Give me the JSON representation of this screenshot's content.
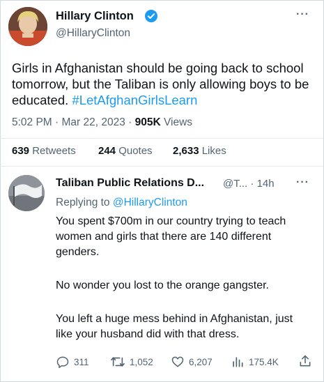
{
  "tweet": {
    "author": "Hillary Clinton",
    "handle": "@HillaryClinton",
    "text": "Girls in Afghanistan should be going back to school tomorrow, but the Taliban is only allowing boys to be educated. ",
    "hashtag": "#LetAfghanGirlsLearn",
    "time": "5:02 PM · Mar 22, 2023 · ",
    "views_count": "905K",
    "views_label": " Views",
    "retweets_count": "639",
    "retweets_label": " Retweets",
    "quotes_count": "244",
    "quotes_label": " Quotes",
    "likes_count": "2,633",
    "likes_label": " Likes"
  },
  "reply": {
    "author": "Taliban Public Relations D...",
    "handle": "@T...",
    "time": " · 14h",
    "replying_prefix": "Replying to ",
    "replying_handle": "@HillaryClinton",
    "paragraph1": "You spent $700m in our country trying to teach women and girls that there are 140 different genders.",
    "paragraph2": "No wonder you lost to the orange gangster.",
    "paragraph3": "You left a huge mess behind in Afghanistan, just like your husband did with that dress.",
    "replies": "311",
    "retweets": "1,052",
    "likes": "6,207",
    "views": "175.4K"
  },
  "colors": {
    "accent": "#1d9bf0",
    "secondary_text": "#536471",
    "primary_text": "#0f1419"
  },
  "icons": [
    "verified-badge-icon",
    "more-icon",
    "reply-icon",
    "retweet-icon",
    "like-icon",
    "views-icon",
    "share-icon"
  ]
}
